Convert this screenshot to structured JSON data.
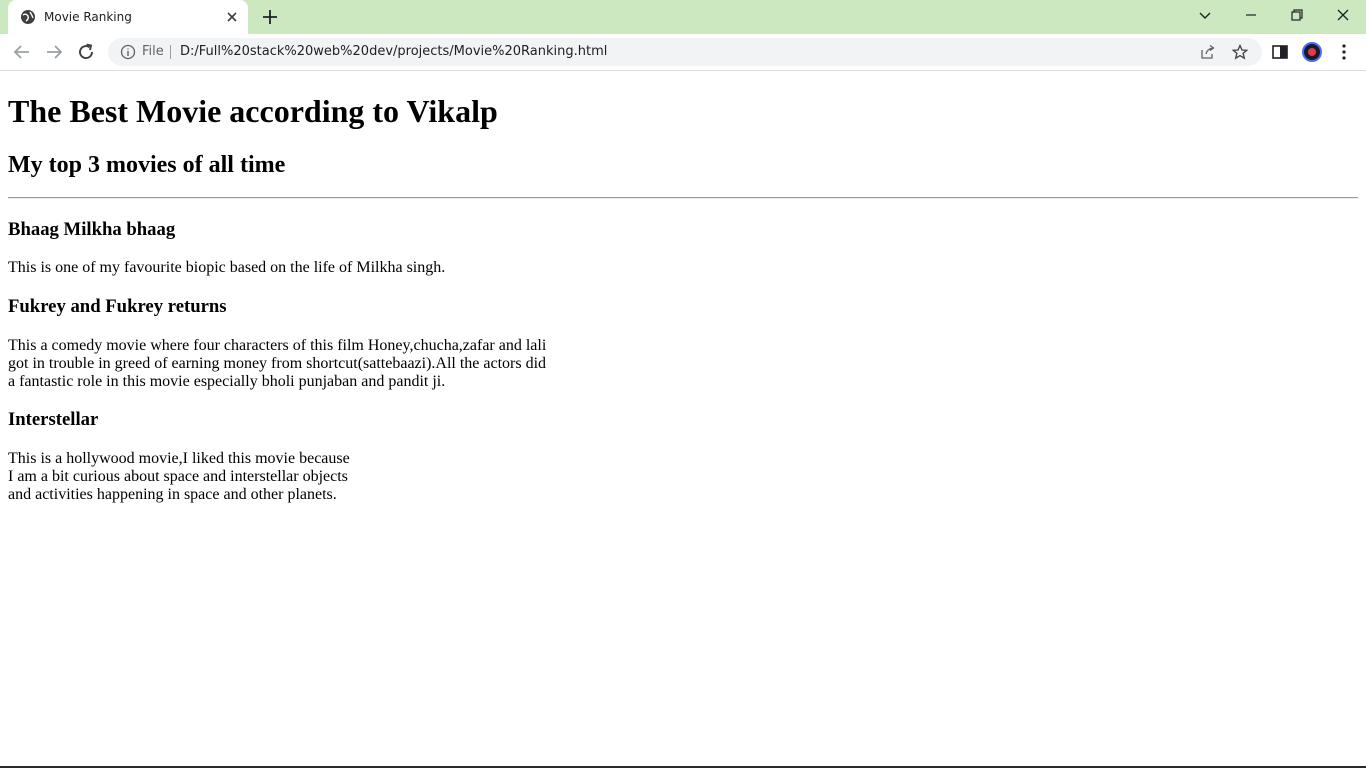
{
  "browser": {
    "tab_title": "Movie Ranking",
    "scheme_label": "File",
    "url": "D:/Full%20stack%20web%20dev/projects/Movie%20Ranking.html",
    "tab_strip_color": "#cbe8c1"
  },
  "page": {
    "heading": "The Best Movie according to Vikalp",
    "subheading": "My top 3 movies of all time",
    "movies": [
      {
        "title": "Bhaag Milkha bhaag",
        "description": "This is one of my favourite biopic based on the life of Milkha singh."
      },
      {
        "title": "Fukrey and Fukrey returns",
        "description": "This a comedy movie where four characters of this film Honey,chucha,zafar and lali\ngot in trouble in greed of earning money from shortcut(sattebaazi).All the actors did\na fantastic role in this movie especially bholi punjaban and pandit ji."
      },
      {
        "title": "Interstellar",
        "description": "This is a hollywood movie,I liked this movie because\nI am a bit curious about space and interstellar objects\nand activities happening in space and other planets."
      }
    ]
  }
}
